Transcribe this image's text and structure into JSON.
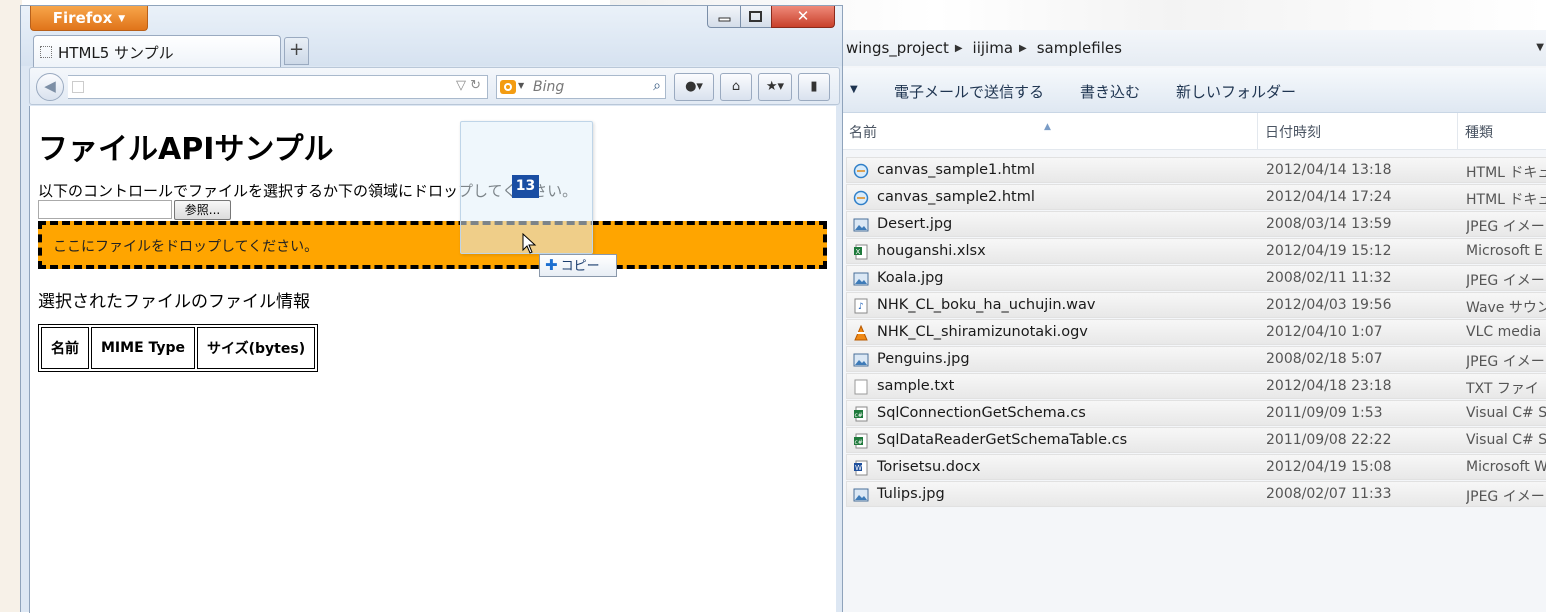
{
  "explorer": {
    "breadcrumb": [
      "wings_project",
      "iijima",
      "samplefiles"
    ],
    "toolbar": [
      "電子メールで送信する",
      "書き込む",
      "新しいフォルダー"
    ],
    "columns": {
      "name": "名前",
      "date": "日付時刻",
      "type": "種類"
    },
    "files": [
      {
        "name": "canvas_sample1.html",
        "date": "2012/04/14 13:18",
        "type": "HTML ドキュ",
        "icon": "html-icon"
      },
      {
        "name": "canvas_sample2.html",
        "date": "2012/04/14 17:24",
        "type": "HTML ドキュ",
        "icon": "html-icon"
      },
      {
        "name": "Desert.jpg",
        "date": "2008/03/14 13:59",
        "type": "JPEG イメー",
        "icon": "image-icon"
      },
      {
        "name": "houganshi.xlsx",
        "date": "2012/04/19 15:12",
        "type": "Microsoft E",
        "icon": "excel-icon"
      },
      {
        "name": "Koala.jpg",
        "date": "2008/02/11 11:32",
        "type": "JPEG イメー",
        "icon": "image-icon"
      },
      {
        "name": "NHK_CL_boku_ha_uchujin.wav",
        "date": "2012/04/03 19:56",
        "type": "Wave サウン",
        "icon": "audio-icon"
      },
      {
        "name": "NHK_CL_shiramizunotaki.ogv",
        "date": "2012/04/10 1:07",
        "type": "VLC media",
        "icon": "vlc-icon"
      },
      {
        "name": "Penguins.jpg",
        "date": "2008/02/18 5:07",
        "type": "JPEG イメー",
        "icon": "image-icon"
      },
      {
        "name": "sample.txt",
        "date": "2012/04/18 23:18",
        "type": "TXT ファイ",
        "icon": "text-icon"
      },
      {
        "name": "SqlConnectionGetSchema.cs",
        "date": "2011/09/09 1:53",
        "type": "Visual C# S",
        "icon": "csharp-icon"
      },
      {
        "name": "SqlDataReaderGetSchemaTable.cs",
        "date": "2011/09/08 22:22",
        "type": "Visual C# S",
        "icon": "csharp-icon"
      },
      {
        "name": "Torisetsu.docx",
        "date": "2012/04/19 15:08",
        "type": "Microsoft W",
        "icon": "word-icon"
      },
      {
        "name": "Tulips.jpg",
        "date": "2008/02/07 11:33",
        "type": "JPEG イメー",
        "icon": "image-icon"
      }
    ]
  },
  "firefox": {
    "menu_label": "Firefox",
    "tab_title": "HTML5 サンプル",
    "search_placeholder": "Bing",
    "url_value": ""
  },
  "page": {
    "title": "ファイルAPIサンプル",
    "instructions": "以下のコントロールでファイルを選択するか下の領域にドロップしてください。",
    "browse_label": "参照...",
    "dropzone_text": "ここにファイルをドロップしてください。",
    "info_heading": "選択されたファイルのファイル情報",
    "table_headers": [
      "名前",
      "MIME Type",
      "サイズ(bytes)"
    ]
  },
  "drag": {
    "count": "13",
    "tooltip": "コピー"
  },
  "colors": {
    "dropzone": "#ffa500",
    "firefox_button": "#e0741a",
    "badge": "#1a4ea3"
  }
}
